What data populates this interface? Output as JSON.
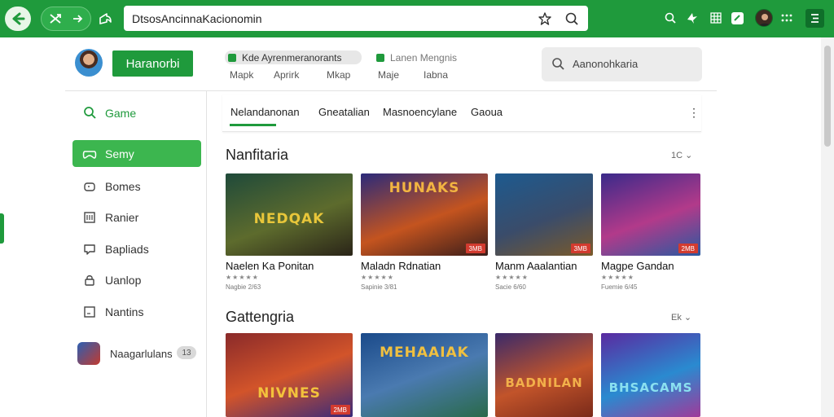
{
  "browser": {
    "address": "DtsosAncinnaKacionomin"
  },
  "header": {
    "brand_label": "Haranorbi",
    "filter_chips": [
      {
        "label": "Kde Ayrenmeranorants"
      },
      {
        "label": "Lanen Mengnis"
      }
    ],
    "links": [
      "Mapk",
      "Aprirk",
      "Mkap",
      "Maje",
      "Iabna"
    ],
    "search_placeholder": "Aanonohkaria"
  },
  "sidebar": {
    "items": [
      {
        "label": "Game",
        "icon": "search-icon"
      },
      {
        "label": "Semy",
        "icon": "gamepad-icon"
      },
      {
        "label": "Bomes",
        "icon": "controller-icon"
      },
      {
        "label": "Ranier",
        "icon": "building-icon"
      },
      {
        "label": "Bapliads",
        "icon": "chat-icon"
      },
      {
        "label": "Uanlop",
        "icon": "lock-icon"
      },
      {
        "label": "Nantins",
        "icon": "square-icon"
      }
    ],
    "user": {
      "name": "Naagarlulans",
      "badge": "13"
    }
  },
  "tabs": [
    "Nelandanonan",
    "Gneatalian",
    "Masnoencylane",
    "Gaoua"
  ],
  "sections": [
    {
      "title": "Nanfitaria",
      "control": "1C",
      "cards": [
        {
          "name": "Naelen Ka Ponitan",
          "meta": "Nagbie 2/63",
          "tag": "",
          "art_title": "NEDQAK"
        },
        {
          "name": "Maladn Rdnatian",
          "meta": "Sapinie 3/81",
          "tag": "3MB",
          "art_title": "HUNAKS"
        },
        {
          "name": "Manm Aaalantian",
          "meta": "Sacie 6/60",
          "tag": "3MB",
          "art_title": ""
        },
        {
          "name": "Magpe Gandan",
          "meta": "Fuemie 6/45",
          "tag": "2MB",
          "art_title": ""
        }
      ]
    },
    {
      "title": "Gattengria",
      "control": "Ek",
      "cards": [
        {
          "name": "",
          "meta": "",
          "tag": "2MB",
          "art_title": "NIVNES"
        },
        {
          "name": "",
          "meta": "",
          "tag": "",
          "art_title": "MEHAAIAK"
        },
        {
          "name": "",
          "meta": "",
          "tag": "",
          "art_title": "BADNILAN"
        },
        {
          "name": "",
          "meta": "",
          "tag": "",
          "art_title": "BHSACAMS"
        }
      ]
    }
  ],
  "colors": {
    "accent": "#1f9a3c",
    "tag": "#d23b2f"
  }
}
